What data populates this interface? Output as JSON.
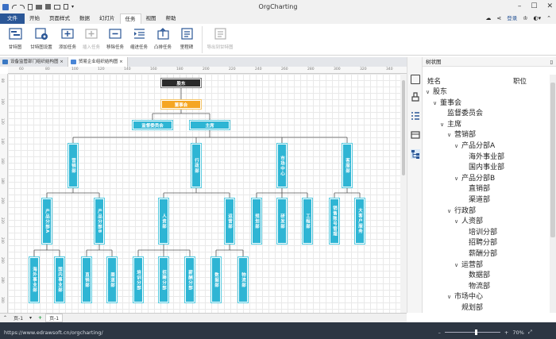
{
  "app": {
    "title": "OrgCharting"
  },
  "menu": {
    "items": [
      "文件",
      "开始",
      "页面样式",
      "数据",
      "幻灯片",
      "任务",
      "视图",
      "帮助"
    ],
    "active": "任务",
    "login": "登录",
    "share_label": "共享"
  },
  "ribbon": {
    "buttons": [
      "甘特图",
      "甘特图设置",
      "添加任务",
      "插入任务",
      "移除任务",
      "缩进任务",
      "凸排任务",
      "里程碑",
      "导出到甘特图"
    ]
  },
  "doctabs": [
    "设备监管部门组织结构图",
    "贸易企业组织结构图"
  ],
  "ruler": {
    "h": [
      "60",
      "80",
      "100",
      "120",
      "140",
      "160",
      "180",
      "200",
      "220",
      "240",
      "260",
      "280",
      "300",
      "320",
      "340"
    ],
    "v": [
      "80",
      "100",
      "120",
      "140",
      "160",
      "180",
      "200",
      "220",
      "240",
      "260",
      "280",
      "300"
    ]
  },
  "chart": {
    "root": "股东",
    "board": "董事会",
    "supervisory": "监督委员会",
    "chairman": "主席",
    "departments": [
      "营销部",
      "行政部",
      "市场中心",
      "客服部"
    ],
    "marketing_subs": [
      "产品分部A",
      "产品分部B"
    ],
    "admin_subs": [
      "人资部",
      "运营部"
    ],
    "market_subs": [
      "规划部",
      "研发部",
      "工程部"
    ],
    "service_subs": [
      "销售账号管理",
      "大客户服务"
    ],
    "pa_subs": [
      "海外事业部",
      "国内事业部"
    ],
    "pb_subs": [
      "直销部",
      "渠道部"
    ],
    "hr_subs": [
      "培训分部",
      "招聘分部",
      "薪酬分部"
    ],
    "ops_subs": [
      "数据部",
      "物流部"
    ]
  },
  "panel": {
    "title": "树状图",
    "col_name": "姓名",
    "col_title": "职位",
    "tree": [
      {
        "label": "股东",
        "level": 0,
        "arrow": "∨"
      },
      {
        "label": "董事会",
        "level": 1,
        "arrow": "∨"
      },
      {
        "label": "监督委员会",
        "level": 2,
        "arrow": ""
      },
      {
        "label": "主席",
        "level": 2,
        "arrow": "∨"
      },
      {
        "label": "营销部",
        "level": 3,
        "arrow": "∨"
      },
      {
        "label": "产品分部A",
        "level": 4,
        "arrow": "∨"
      },
      {
        "label": "海外事业部",
        "level": 5,
        "arrow": ""
      },
      {
        "label": "国内事业部",
        "level": 5,
        "arrow": ""
      },
      {
        "label": "产品分部B",
        "level": 4,
        "arrow": "∨"
      },
      {
        "label": "直销部",
        "level": 5,
        "arrow": ""
      },
      {
        "label": "渠道部",
        "level": 5,
        "arrow": ""
      },
      {
        "label": "行政部",
        "level": 3,
        "arrow": "∨"
      },
      {
        "label": "人资部",
        "level": 4,
        "arrow": "∨"
      },
      {
        "label": "培训分部",
        "level": 5,
        "arrow": ""
      },
      {
        "label": "招聘分部",
        "level": 5,
        "arrow": ""
      },
      {
        "label": "薪酬分部",
        "level": 5,
        "arrow": ""
      },
      {
        "label": "运营部",
        "level": 4,
        "arrow": "∨"
      },
      {
        "label": "数据部",
        "level": 5,
        "arrow": ""
      },
      {
        "label": "物流部",
        "level": 5,
        "arrow": ""
      },
      {
        "label": "市场中心",
        "level": 3,
        "arrow": "∨"
      },
      {
        "label": "规划部",
        "level": 4,
        "arrow": ""
      }
    ]
  },
  "pagetabs": {
    "current": "页-1",
    "add": "+",
    "page": "页-1"
  },
  "status": {
    "url": "https://www.edrawsoft.cn/orgcharting/",
    "zoom": "70%"
  }
}
